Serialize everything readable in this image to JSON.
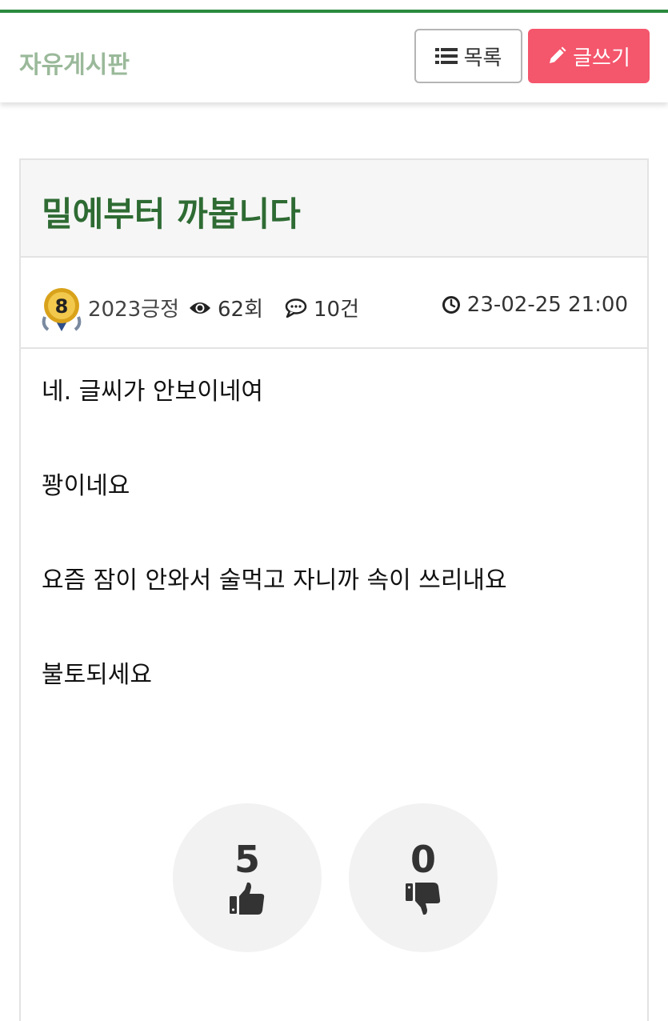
{
  "header": {
    "board_title": "자유게시판",
    "list_label": "목록",
    "write_label": "글쓰기"
  },
  "post": {
    "title": "밀에부터 까봅니다",
    "author": "2023긍정",
    "level": "8",
    "views": "62회",
    "comments": "10건",
    "date": "23-02-25 21:00",
    "lines": [
      "네. 글씨가 안보이네여",
      "꽝이네요",
      "요즘 잠이 안와서 술먹고 자니까 속이 쓰리내요",
      "불토되세요"
    ],
    "likes": "5",
    "dislikes": "0"
  },
  "colors": {
    "accent_green": "#2b8a3e",
    "title_green": "#2e6b33",
    "write_button": "#f4566c"
  },
  "icons": [
    "list-icon",
    "pencil-icon",
    "level-badge-icon",
    "eye-icon",
    "comment-icon",
    "clock-icon",
    "thumbs-up-icon",
    "thumbs-down-icon"
  ]
}
